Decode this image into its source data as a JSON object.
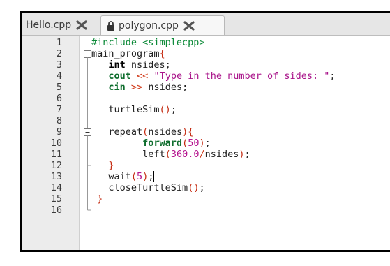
{
  "tabs": [
    {
      "label": "Hello.cpp",
      "active": false
    },
    {
      "label": "polygon.cpp",
      "active": true
    }
  ],
  "icons": {
    "tab_lock": "lock-icon",
    "tab_close": "close-icon"
  },
  "line_numbers": [
    "1",
    "2",
    "3",
    "4",
    "5",
    "6",
    "7",
    "8",
    "9",
    "10",
    "11",
    "12",
    "13",
    "14",
    "15",
    "16"
  ],
  "code_tokens": {
    "l1_include": "#include <simplecpp>",
    "l2_main": "main_program",
    "l2_brace": "{",
    "l3_type": "int",
    "l3_rest": " nsides;",
    "l4_cout": "cout",
    "l4_op": "<<",
    "l4_str": "\"Type in the number of sides: \"",
    "l4_end": ";",
    "l5_cin": "cin",
    "l5_op": ">>",
    "l5_rest": " nsides;",
    "l7": "turtleSim",
    "l7_paren": "()",
    "l7_end": ";",
    "l9_fn": "repeat",
    "l9_open": "(",
    "l9_arg": "nsides",
    "l9_close": ")",
    "l9_brace": "{",
    "l10_fn": "forward",
    "l10_open": "(",
    "l10_num": "50",
    "l10_close": ")",
    "l10_end": ";",
    "l11_fn": "left",
    "l11_open": "(",
    "l11_num": "360.0",
    "l11_op": "/",
    "l11_arg": "nsides",
    "l11_close": ")",
    "l11_end": ";",
    "l12_brace": "}",
    "l13_fn": "wait",
    "l13_open": "(",
    "l13_num": "5",
    "l13_close": ")",
    "l13_end": ";",
    "l14_fn": "closeTurtleSim",
    "l14_paren": "()",
    "l14_end": ";",
    "l15_brace": "}"
  },
  "colors": {
    "keyword": "#0e6d2d",
    "string": "#a9148a",
    "number": "#b5158f",
    "operator": "#d13b1a"
  }
}
